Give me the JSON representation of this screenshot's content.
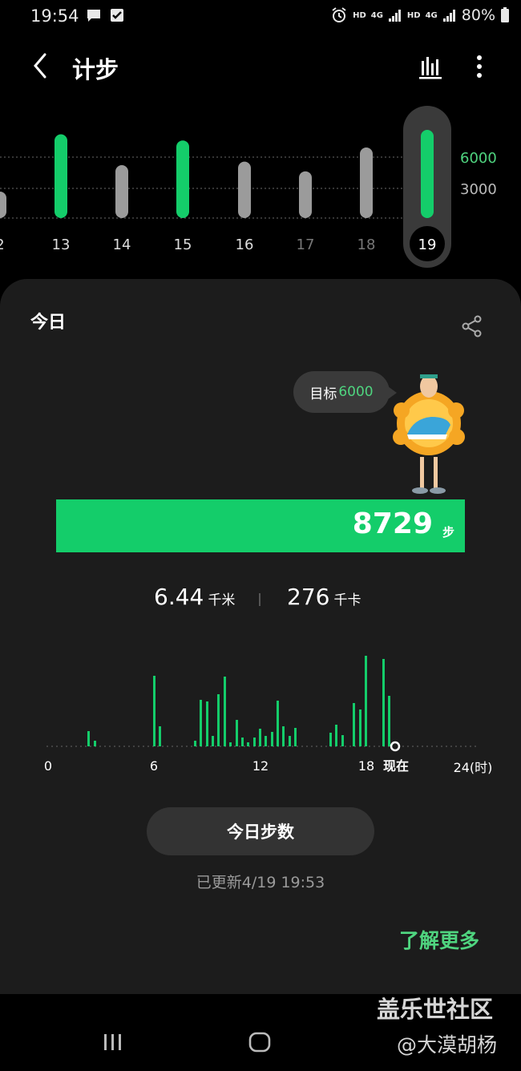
{
  "status_bar": {
    "time": "19:54",
    "hd1": "HD",
    "net1": "4G",
    "hd2": "HD",
    "net2": "4G",
    "battery": "80%"
  },
  "header": {
    "title": "计步"
  },
  "week_chart": {
    "days": [
      "2",
      "13",
      "14",
      "15",
      "16",
      "17",
      "18",
      "19"
    ],
    "selected_day": "19",
    "reference_lines": [
      "6000",
      "3000"
    ],
    "goal_met": [
      false,
      true,
      false,
      true,
      false,
      false,
      false,
      true
    ],
    "levels": [
      0.3,
      0.95,
      0.6,
      0.88,
      0.64,
      0.53,
      0.8,
      1.0
    ],
    "colors": {
      "met": "#14cd6a",
      "unmet": "#9b9b9b",
      "goal_label": "#4fd47f",
      "other_label": "#bbbbbb"
    }
  },
  "card": {
    "title": "今日",
    "goal_label": "目标",
    "goal_value": "6000",
    "steps": "8729",
    "steps_unit": "步",
    "distance": "6.44",
    "distance_unit": "千米",
    "calories": "276",
    "calories_unit": "千卡",
    "hourly_axis": [
      "0",
      "6",
      "12",
      "18",
      "现在",
      "24(时)"
    ],
    "button_label": "今日步数",
    "updated": "已更新4/19 19:53",
    "learn_more": "了解更多"
  },
  "watermark": {
    "line1": "盖乐世社区",
    "line2": "@大漠胡杨"
  },
  "accent": "#14cd6a"
}
